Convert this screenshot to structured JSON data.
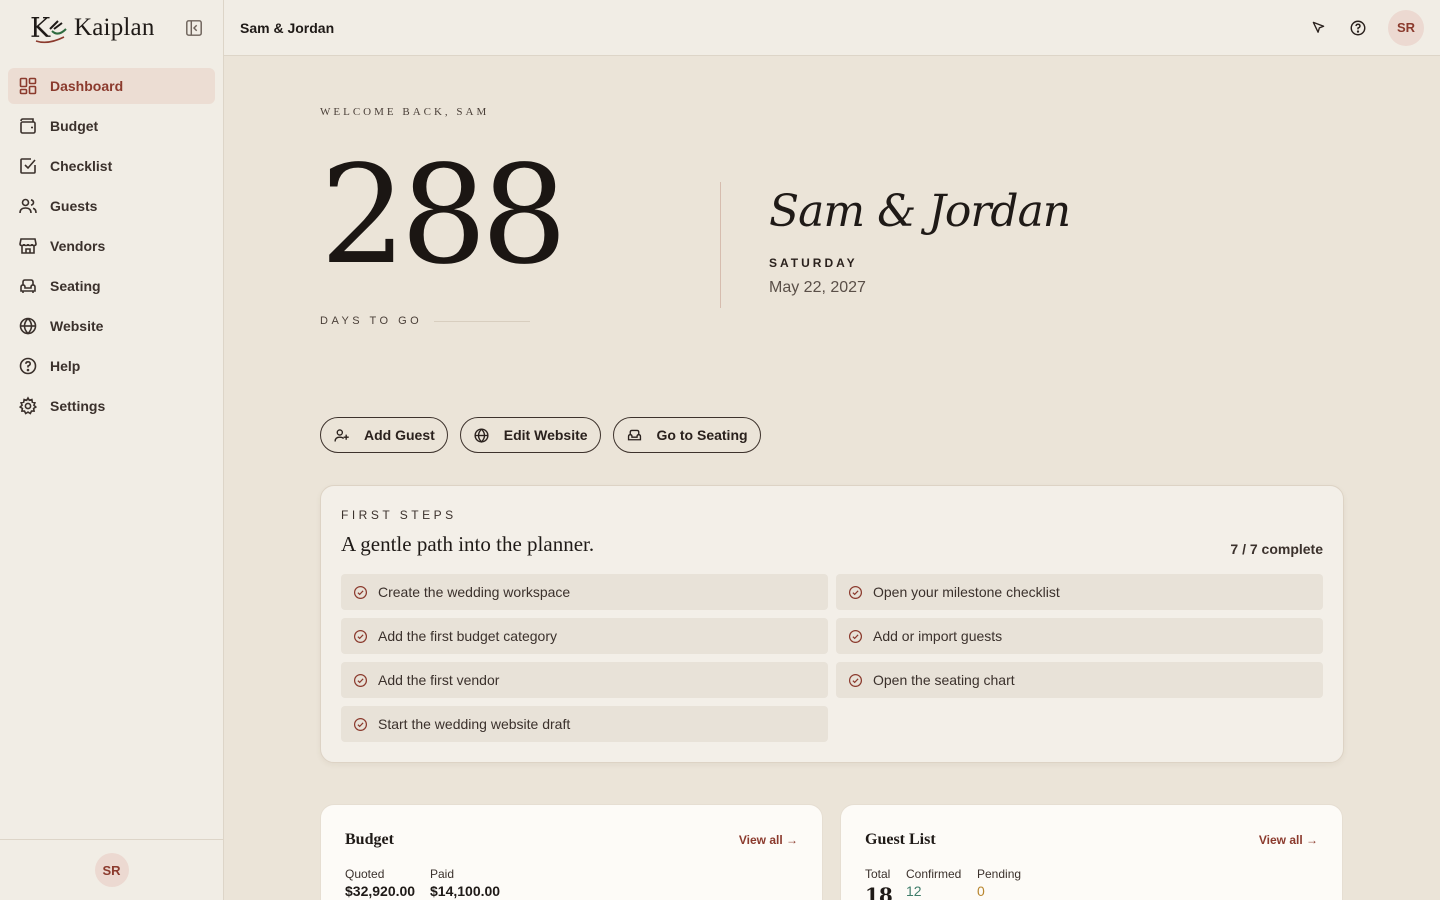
{
  "brand": {
    "mark": "K",
    "name": "Kaiplan"
  },
  "sidebar": {
    "items": [
      {
        "label": "Dashboard",
        "icon": "dashboard-icon",
        "active": true
      },
      {
        "label": "Budget",
        "icon": "wallet-icon"
      },
      {
        "label": "Checklist",
        "icon": "checkbox-icon"
      },
      {
        "label": "Guests",
        "icon": "users-icon"
      },
      {
        "label": "Vendors",
        "icon": "store-icon"
      },
      {
        "label": "Seating",
        "icon": "armchair-icon"
      },
      {
        "label": "Website",
        "icon": "globe-icon"
      },
      {
        "label": "Help",
        "icon": "help-circle-icon"
      },
      {
        "label": "Settings",
        "icon": "gear-icon"
      }
    ],
    "user_initials": "SR"
  },
  "topbar": {
    "title": "Sam & Jordan",
    "user_initials": "SR"
  },
  "hero": {
    "welcome": "WELCOME BACK, SAM",
    "days": "288",
    "days_label": "DAYS TO GO",
    "couple": "Sam & Jordan",
    "weekday": "SATURDAY",
    "date": "May 22, 2027"
  },
  "actions": {
    "add_guest": "Add Guest",
    "edit_website": "Edit Website",
    "go_seating": "Go to Seating"
  },
  "first_steps": {
    "eyebrow": "FIRST STEPS",
    "title": "A gentle path into the planner.",
    "count": "7 / 7 complete",
    "items": [
      "Create the wedding workspace",
      "Open your milestone checklist",
      "Add the first budget category",
      "Add or import guests",
      "Add the first vendor",
      "Open the seating chart",
      "Start the wedding website draft"
    ]
  },
  "budget": {
    "title": "Budget",
    "link": "View all →",
    "quoted_label": "Quoted",
    "quoted_value": "$32,920.00",
    "paid_label": "Paid",
    "paid_value": "$14,100.00"
  },
  "guests": {
    "title": "Guest List",
    "link": "View all →",
    "total_label": "Total",
    "total_value": "18",
    "confirmed_label": "Confirmed",
    "confirmed_value": "12",
    "pending_label": "Pending",
    "pending_value": "0"
  },
  "colors": {
    "accent": "#8b3a2d",
    "confirmed": "#3f7d6a",
    "pending": "#b8862f"
  }
}
